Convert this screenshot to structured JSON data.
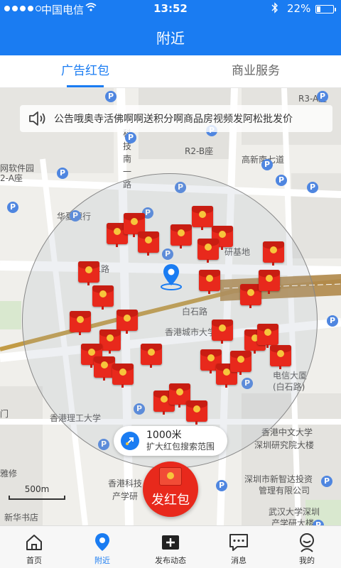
{
  "status_bar": {
    "carrier": "中国电信",
    "time": "13:52",
    "battery_pct": "22%",
    "battery_level": 0.22
  },
  "nav": {
    "title": "附近"
  },
  "tabs": [
    {
      "label": "广告红包",
      "active": true
    },
    {
      "label": "商业服务",
      "active": false
    }
  ],
  "notice": {
    "text": "公告哦奥寺活佛啊啊送积分啊商品房视频发阿松批发价"
  },
  "map": {
    "labels": [
      "科",
      "技",
      "南",
      "一",
      "路",
      "R2-B座",
      "R3-A座",
      "高新南七道",
      "网软件园",
      "2-A座",
      "华夏银行",
      "研基地",
      "二路",
      "白石路",
      "香港城市大学",
      "电信大厦",
      "(白石路)",
      "香港理工大学",
      "香港中文大学",
      "深圳研究院大楼",
      "深圳市新智达投资",
      "管理有限公司",
      "香港科技",
      "产学研",
      "门",
      "雅修",
      "武汉大学深圳",
      "产学研大楼",
      "新华书店"
    ],
    "scale_label": "500m"
  },
  "range_chip": {
    "distance": "1000米",
    "hint": "扩大红包搜索范围"
  },
  "send_button": {
    "label": "发红包"
  },
  "tabbar": [
    {
      "label": "首页",
      "icon": "home-icon",
      "active": false
    },
    {
      "label": "附近",
      "icon": "location-icon",
      "active": true
    },
    {
      "label": "发布动态",
      "icon": "add-icon",
      "active": false
    },
    {
      "label": "消息",
      "icon": "message-icon",
      "active": false
    },
    {
      "label": "我的",
      "icon": "profile-icon",
      "active": false
    }
  ],
  "colors": {
    "primary": "#1a7cf2",
    "packet_red": "#e8291c",
    "seal_gold": "#f7c53b"
  }
}
